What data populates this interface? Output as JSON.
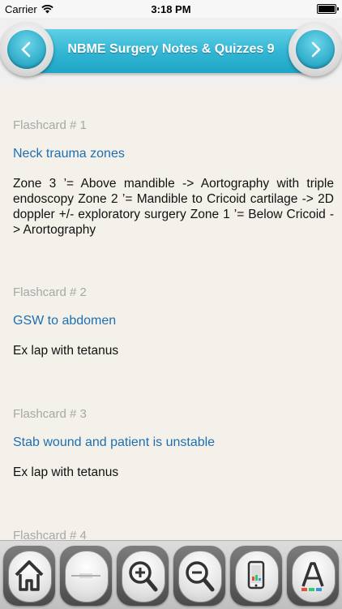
{
  "status_bar": {
    "carrier": "Carrier",
    "time": "3:18 PM"
  },
  "header": {
    "title": "NBME Surgery Notes & Quizzes 9",
    "back_icon": "chevron-left-icon",
    "forward_icon": "chevron-right-icon",
    "accent_color": "#31b5d3"
  },
  "cards": [
    {
      "label": "Flashcard # 1",
      "title": "Neck trauma zones",
      "body": "Zone 3 ’= Above mandible -> Aortography with triple endoscopy Zone 2 ’= Mandible to Cricoid cartilage -> 2D doppler +/- exploratory surgery Zone 1 ’= Below Cricoid -> Arortography"
    },
    {
      "label": "Flashcard # 2",
      "title": "GSW to abdomen",
      "body": "Ex lap with tetanus"
    },
    {
      "label": "Flashcard # 3",
      "title": "Stab wound and patient is unstable",
      "body": "Ex lap with tetanus"
    },
    {
      "label": "Flashcard # 4",
      "title": "",
      "body": ""
    }
  ],
  "toolbar": {
    "icons": [
      "home-icon",
      "flip-card-icon",
      "zoom-in-icon",
      "zoom-out-icon",
      "device-settings-icon",
      "font-style-icon"
    ]
  },
  "colors": {
    "label": "#a7a7a7",
    "title": "#1f6fb0",
    "body": "#111111",
    "background": "#f3f1ea"
  }
}
